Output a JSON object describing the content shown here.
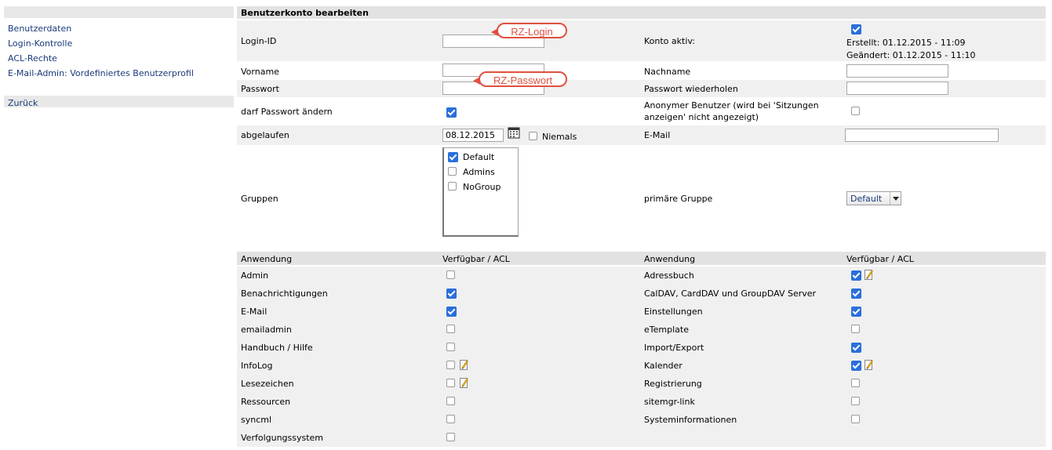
{
  "sidebar": {
    "items": [
      "Benutzerdaten",
      "Login-Kontrolle",
      "ACL-Rechte",
      "E-Mail-Admin: Vordefiniertes Benutzerprofil"
    ],
    "back": "Zurück"
  },
  "form": {
    "title": "Benutzerkonto bearbeiten",
    "login_label": "Login-ID",
    "login_value": "",
    "login_callout": "RZ-Login",
    "active_label": "Konto aktiv:",
    "active_checked": true,
    "created": "Erstellt: 01.12.2015 - 11:09",
    "changed": "Geändert: 01.12.2015 - 11:10",
    "firstname_label": "Vorname",
    "lastname_label": "Nachname",
    "password_label": "Passwort",
    "password_callout": "RZ-Passwort",
    "password_repeat_label": "Passwort wiederholen",
    "may_change_pw_label": "darf Passwort ändern",
    "may_change_pw_checked": true,
    "anon_label_1": "Anonymer Benutzer (wird bei 'Sitzungen",
    "anon_label_2": "anzeigen' nicht angezeigt)",
    "anon_checked": false,
    "expires_label": "abgelaufen",
    "expires_value": "08.12.2015",
    "never_label": "Niemals",
    "never_checked": false,
    "email_label": "E-Mail",
    "groups_label": "Gruppen",
    "groups": [
      {
        "name": "Default",
        "checked": true
      },
      {
        "name": "Admins",
        "checked": false
      },
      {
        "name": "NoGroup",
        "checked": false
      }
    ],
    "primary_group_label": "primäre Gruppe",
    "primary_group_value": "Default"
  },
  "apps": {
    "col_app": "Anwendung",
    "col_acl": "Verfügbar / ACL",
    "left": [
      {
        "name": "Admin",
        "checked": false,
        "acl": false
      },
      {
        "name": "Benachrichtigungen",
        "checked": true,
        "acl": false
      },
      {
        "name": "E-Mail",
        "checked": true,
        "acl": false
      },
      {
        "name": "emailadmin",
        "checked": false,
        "acl": false
      },
      {
        "name": "Handbuch / Hilfe",
        "checked": false,
        "acl": false
      },
      {
        "name": "InfoLog",
        "checked": false,
        "acl": true
      },
      {
        "name": "Lesezeichen",
        "checked": false,
        "acl": true
      },
      {
        "name": "Ressourcen",
        "checked": false,
        "acl": false
      },
      {
        "name": "syncml",
        "checked": false,
        "acl": false
      },
      {
        "name": "Verfolgungssystem",
        "checked": false,
        "acl": false
      }
    ],
    "right": [
      {
        "name": "Adressbuch",
        "checked": true,
        "acl": true
      },
      {
        "name": "CalDAV, CardDAV und GroupDAV Server",
        "checked": true,
        "acl": false
      },
      {
        "name": "Einstellungen",
        "checked": true,
        "acl": false
      },
      {
        "name": "eTemplate",
        "checked": false,
        "acl": false
      },
      {
        "name": "Import/Export",
        "checked": true,
        "acl": false
      },
      {
        "name": "Kalender",
        "checked": true,
        "acl": true
      },
      {
        "name": "Registrierung",
        "checked": false,
        "acl": false
      },
      {
        "name": "sitemgr-link",
        "checked": false,
        "acl": false
      },
      {
        "name": "Systeminformationen",
        "checked": false,
        "acl": false
      }
    ]
  }
}
